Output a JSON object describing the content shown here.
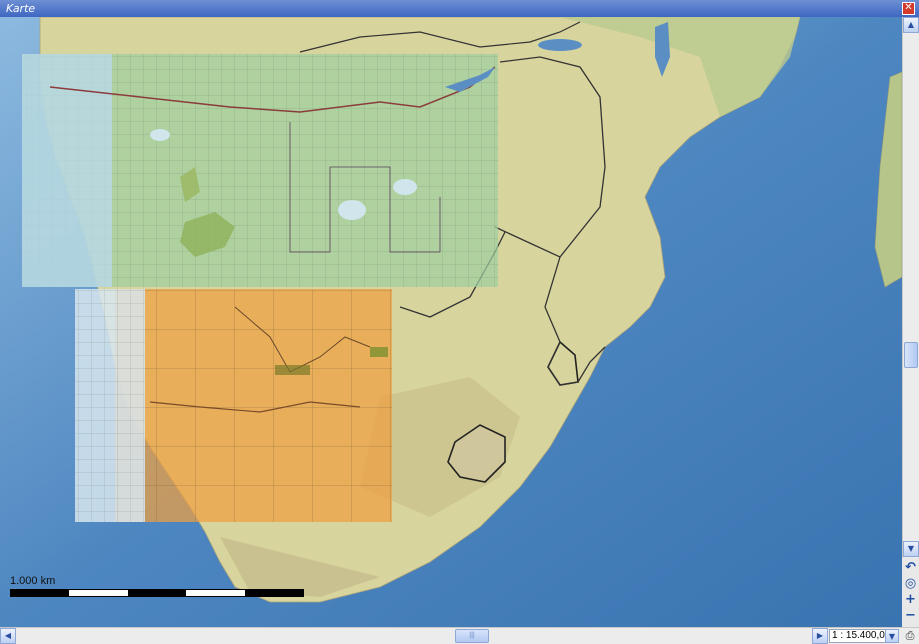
{
  "window": {
    "title": "Karte",
    "close_glyph": "✕"
  },
  "scale": {
    "distance_label": "1.000 km",
    "segments": [
      "black",
      "white",
      "black",
      "white",
      "black"
    ],
    "map_scale": "1 : 15.400,00"
  },
  "colors": {
    "ocean": "#5b8fc4",
    "land": "#dcd9a9",
    "overlay_green": "#9ed0a0",
    "overlay_orange": "#f0a040",
    "overlay_blue": "#b9d8ef",
    "overlay_pale": "#d8e6ee",
    "titlebar": "#3f67c2"
  },
  "icons": {
    "close": "close-icon",
    "scroll_up": "arrow-up-icon",
    "scroll_down": "arrow-down-icon",
    "scroll_left": "arrow-left-icon",
    "scroll_right": "arrow-right-icon",
    "undo": "undo-icon",
    "locate": "target-icon",
    "zoom_in": "plus-icon",
    "zoom_out": "minus-icon",
    "print": "printer-icon",
    "dropdown": "chevron-down-icon"
  },
  "tools": {
    "undo_glyph": "↶",
    "locate_glyph": "◎",
    "zoom_in_glyph": "+",
    "zoom_out_glyph": "−"
  }
}
